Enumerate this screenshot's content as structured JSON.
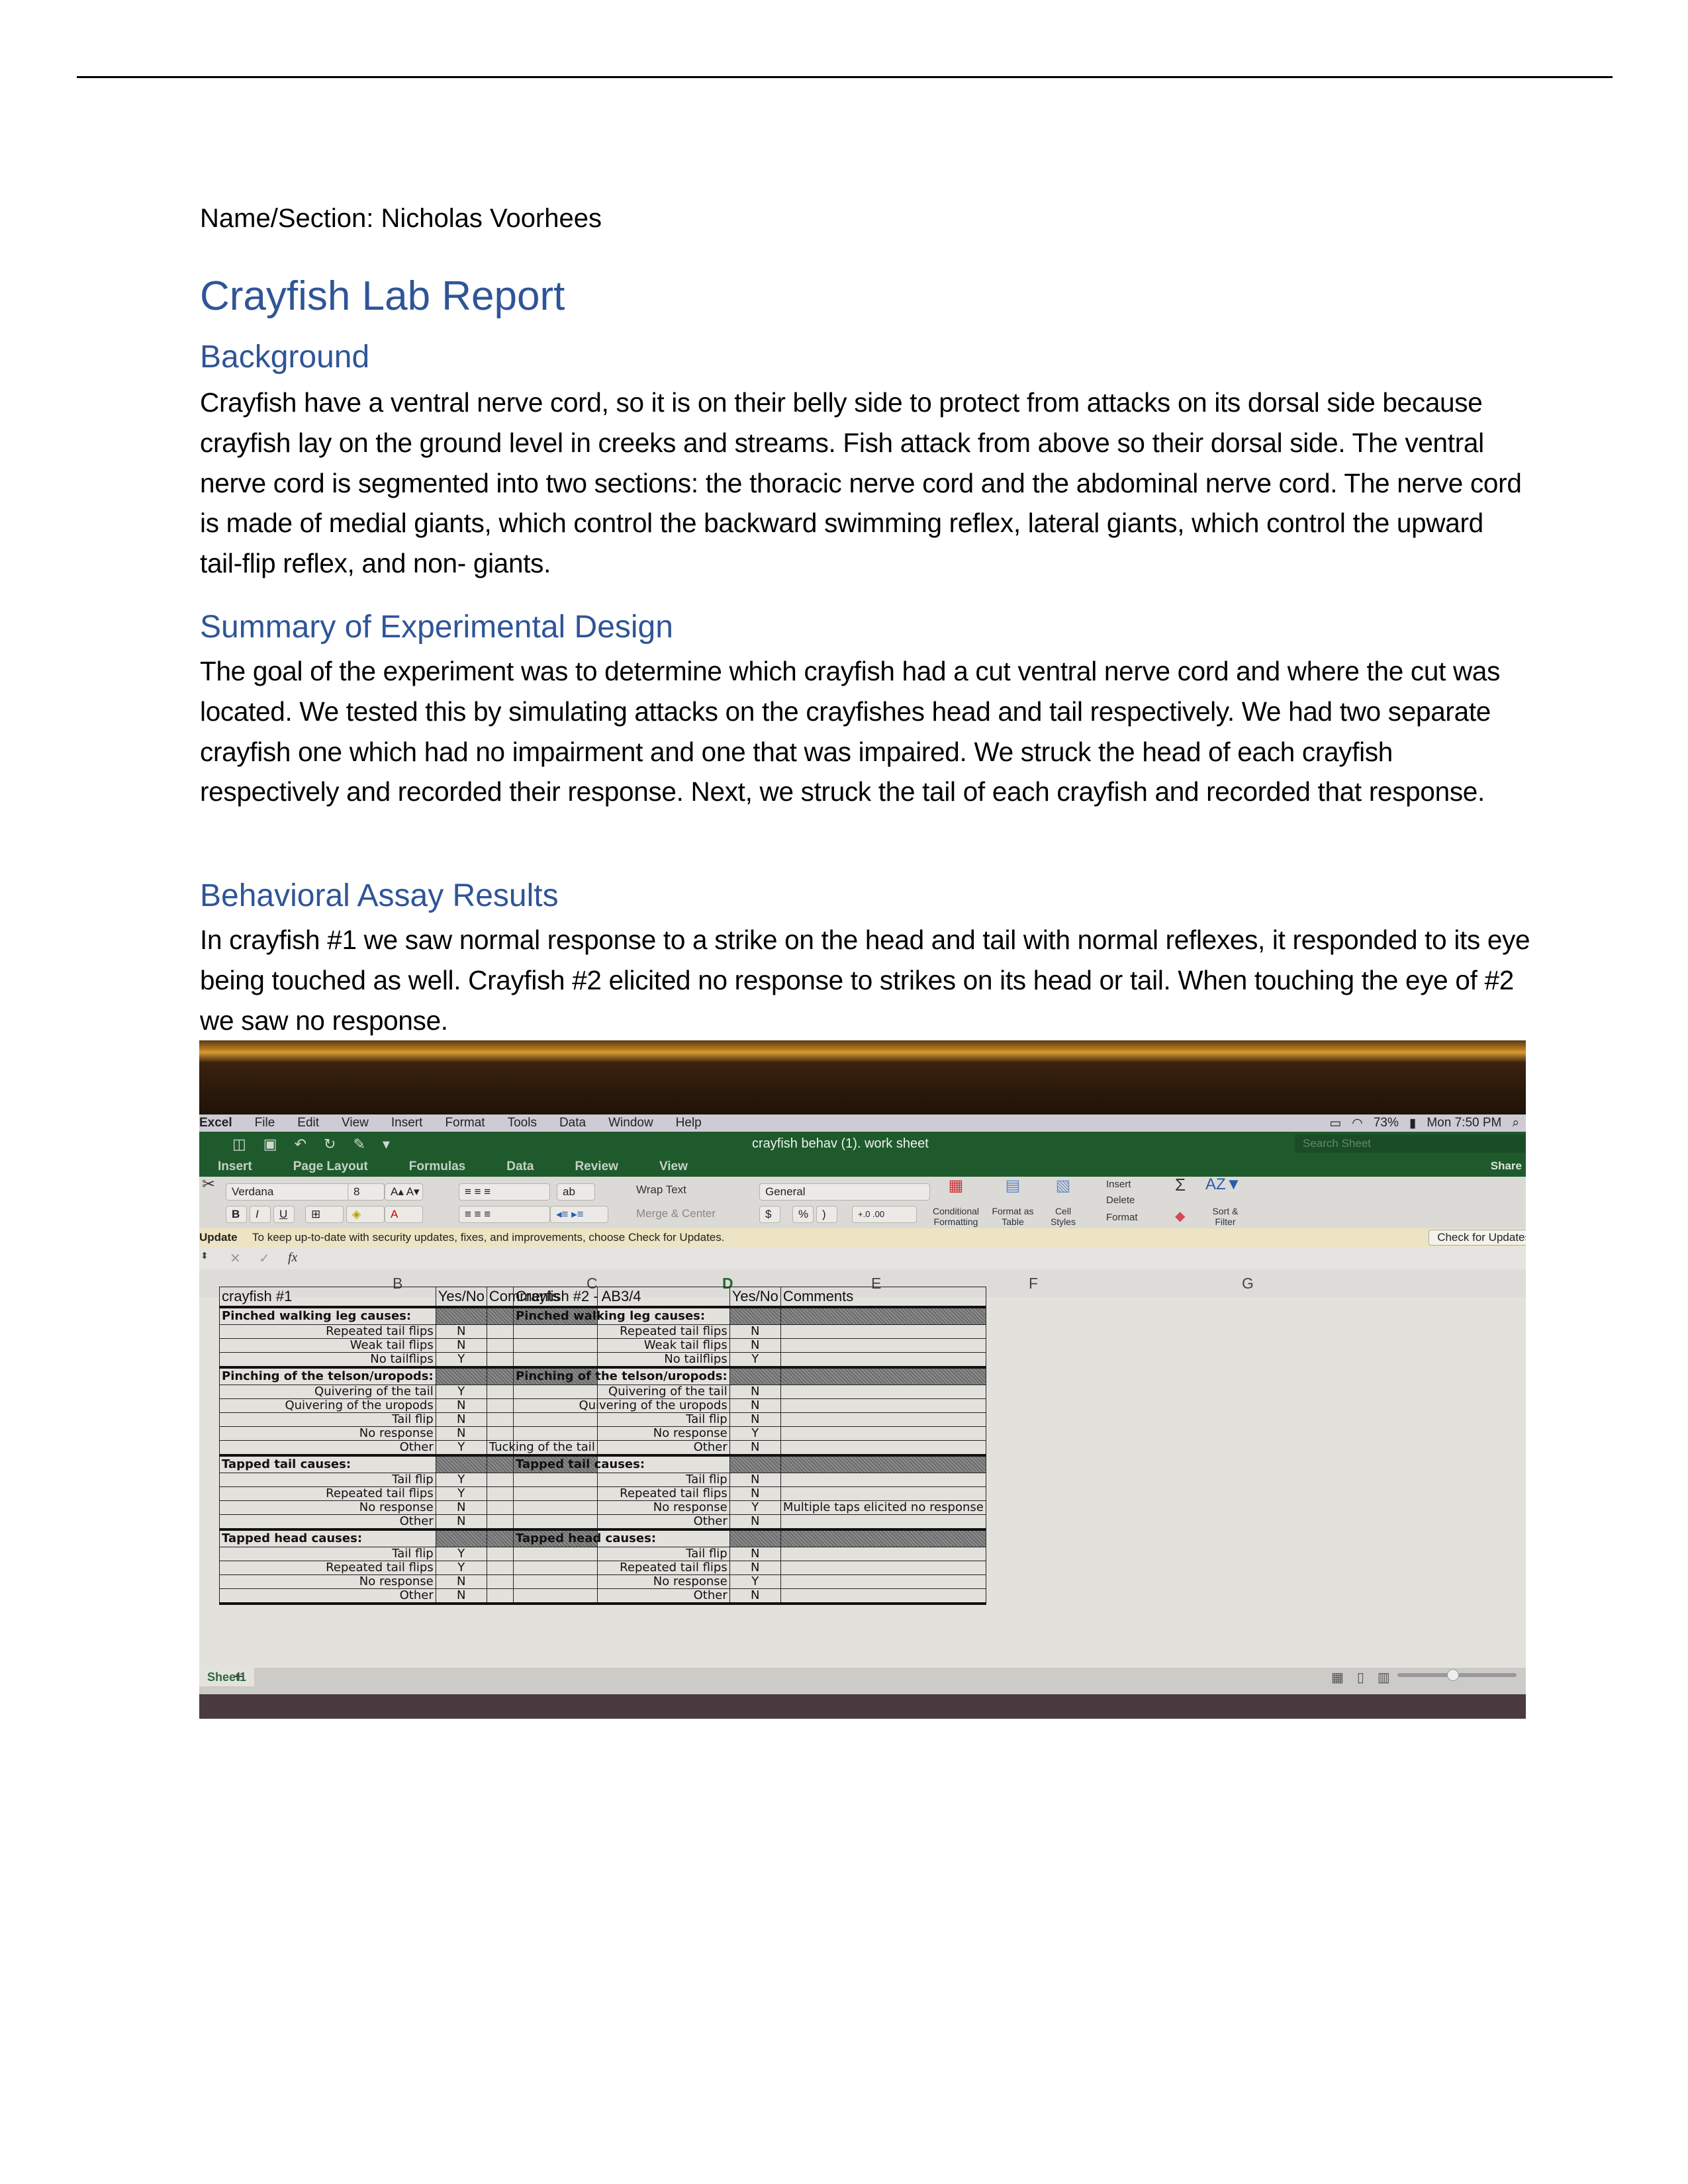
{
  "document": {
    "name_line": "Name/Section: Nicholas Voorhees",
    "title": "Crayfish Lab Report",
    "sections": [
      {
        "heading": "Background",
        "body": "Crayfish have a ventral nerve cord, so it is on their belly side to protect from attacks on its dorsal side because crayfish lay on the ground level in creeks and streams. Fish attack from above so their dorsal side. The ventral nerve cord is segmented into two sections: the thoracic nerve cord and the abdominal nerve cord. The nerve cord is made of medial giants, which control the backward swimming reflex, lateral giants, which control the upward tail-flip reflex, and non- giants."
      },
      {
        "heading": "Summary of Experimental Design",
        "body": "The goal of the experiment was to determine which crayfish had a cut ventral nerve cord and where the cut was located. We tested this by simulating attacks on the crayfishes head and tail respectively. We had two separate crayfish one which had no impairment and one that was impaired. We struck the head of each crayfish respectively and recorded their response. Next, we struck the tail of each crayfish and recorded that response."
      },
      {
        "heading": "Behavioral Assay Results",
        "body": "In crayfish #1 we saw normal response to a strike on the head and tail with normal reflexes, it responded to its eye being touched as well. Crayfish #2 elicited no response to strikes on its head or tail. When touching the eye of #2 we saw no response."
      }
    ]
  },
  "photo": {
    "menubar": {
      "app": "Excel",
      "items": [
        "File",
        "Edit",
        "View",
        "Insert",
        "Format",
        "Tools",
        "Data",
        "Window",
        "Help"
      ],
      "battery": "73%",
      "clock": "Mon 7:50 PM"
    },
    "titlebar": {
      "doc_title": "crayfish behav (1). work sheet",
      "search_placeholder": "Search Sheet",
      "share": "Share"
    },
    "tabs": [
      "Insert",
      "Page Layout",
      "Formulas",
      "Data",
      "Review",
      "View"
    ],
    "ribbon": {
      "font_name": "Verdana",
      "font_size": "8",
      "wrap_text": "Wrap Text",
      "merge_center": "Merge & Center",
      "number_format": "General",
      "currency": "$",
      "percent": "%",
      "comma": ")",
      "conditional_formatting": "Conditional Formatting",
      "format_as_table": "Format as Table",
      "cell_styles": "Cell Styles",
      "insert": "Insert",
      "delete": "Delete",
      "format": "Format",
      "sort_filter": "Sort & Filter",
      "bold": "B",
      "italic": "I",
      "underline": "U"
    },
    "update_bar": {
      "label": "Update",
      "message": "To keep up-to-date with security updates, fixes, and improvements, choose Check for Updates.",
      "button": "Check for Updates"
    },
    "formula_bar": {
      "fx": "fx",
      "cancel": "✕",
      "confirm": "✓"
    },
    "columns": [
      "B",
      "C",
      "D",
      "E",
      "F",
      "G"
    ],
    "sheet_tab": "Sheet1",
    "add_sheet": "+",
    "tables": [
      {
        "title": "crayfish #1",
        "yn_header": "Yes/No",
        "comments_header": "Comments",
        "sections": [
          {
            "name": "Pinched walking leg causes:",
            "rows": [
              {
                "label": "Repeated tail flips",
                "value": "N",
                "comment": ""
              },
              {
                "label": "Weak tail flips",
                "value": "N",
                "comment": ""
              },
              {
                "label": "No tailflips",
                "value": "Y",
                "comment": ""
              }
            ]
          },
          {
            "name": "Pinching of the telson/uropods:",
            "rows": [
              {
                "label": "Quivering of the tail",
                "value": "Y",
                "comment": ""
              },
              {
                "label": "Quivering of the uropods",
                "value": "N",
                "comment": ""
              },
              {
                "label": "Tail flip",
                "value": "N",
                "comment": ""
              },
              {
                "label": "No response",
                "value": "N",
                "comment": ""
              },
              {
                "label": "Other",
                "value": "Y",
                "comment": "Tucking of the tail"
              }
            ]
          },
          {
            "name": "Tapped tail causes:",
            "rows": [
              {
                "label": "Tail flip",
                "value": "Y",
                "comment": ""
              },
              {
                "label": "Repeated tail flips",
                "value": "Y",
                "comment": ""
              },
              {
                "label": "No response",
                "value": "N",
                "comment": ""
              },
              {
                "label": "Other",
                "value": "N",
                "comment": ""
              }
            ]
          },
          {
            "name": "Tapped head causes:",
            "rows": [
              {
                "label": "Tail flip",
                "value": "Y",
                "comment": ""
              },
              {
                "label": "Repeated tail flips",
                "value": "Y",
                "comment": ""
              },
              {
                "label": "No response",
                "value": "N",
                "comment": ""
              },
              {
                "label": "Other",
                "value": "N",
                "comment": ""
              }
            ]
          }
        ]
      },
      {
        "title": "Crayfish #2 - AB3/4",
        "yn_header": "Yes/No",
        "comments_header": "Comments",
        "sections": [
          {
            "name": "Pinched walking leg causes:",
            "rows": [
              {
                "label": "Repeated tail flips",
                "value": "N",
                "comment": ""
              },
              {
                "label": "Weak tail flips",
                "value": "N",
                "comment": ""
              },
              {
                "label": "No tailflips",
                "value": "Y",
                "comment": ""
              }
            ]
          },
          {
            "name": "Pinching of the telson/uropods:",
            "rows": [
              {
                "label": "Quivering of the tail",
                "value": "N",
                "comment": ""
              },
              {
                "label": "Quivering of the uropods",
                "value": "N",
                "comment": ""
              },
              {
                "label": "Tail flip",
                "value": "N",
                "comment": ""
              },
              {
                "label": "No response",
                "value": "Y",
                "comment": ""
              },
              {
                "label": "Other",
                "value": "N",
                "comment": ""
              }
            ]
          },
          {
            "name": "Tapped tail causes:",
            "rows": [
              {
                "label": "Tail flip",
                "value": "N",
                "comment": ""
              },
              {
                "label": "Repeated tail flips",
                "value": "N",
                "comment": ""
              },
              {
                "label": "No response",
                "value": "Y",
                "comment": "Multiple  taps elicited no response"
              },
              {
                "label": "Other",
                "value": "N",
                "comment": ""
              }
            ]
          },
          {
            "name": "Tapped head causes:",
            "rows": [
              {
                "label": "Tail flip",
                "value": "N",
                "comment": ""
              },
              {
                "label": "Repeated tail flips",
                "value": "N",
                "comment": ""
              },
              {
                "label": "No response",
                "value": "Y",
                "comment": ""
              },
              {
                "label": "Other",
                "value": "N",
                "comment": ""
              }
            ]
          }
        ]
      }
    ],
    "colors": {
      "heading_blue": "#2f5597",
      "excel_green": "#1f5a2c",
      "update_bar": "#ece4c3"
    }
  }
}
